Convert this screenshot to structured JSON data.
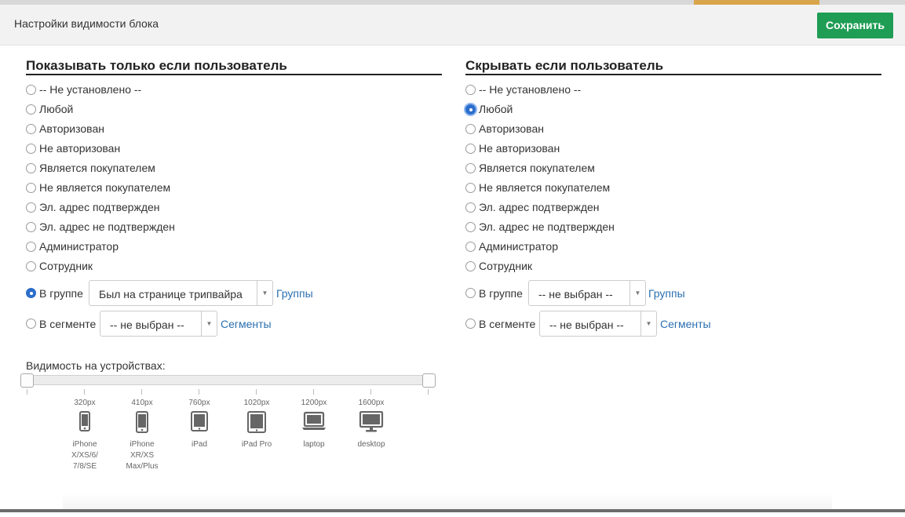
{
  "modal": {
    "title": "Настройки видимости блока",
    "save_label": "Сохранить"
  },
  "show_section": {
    "title": "Показывать только если пользователь",
    "options": [
      "-- Не установлено --",
      "Любой",
      "Авторизован",
      "Не авторизован",
      "Является покупателем",
      "Не является покупателем",
      "Эл. адрес подтвержден",
      "Эл. адрес не подтвержден",
      "Администратор",
      "Сотрудник"
    ],
    "selected": "В группе",
    "group": {
      "label": "В группе",
      "select_value": "Был на странице трипвайра",
      "link": "Группы"
    },
    "segment": {
      "label": "В сегменте",
      "select_value": "-- не выбран --",
      "link": "Сегменты"
    }
  },
  "hide_section": {
    "title": "Скрывать если пользователь",
    "options": [
      "-- Не установлено --",
      "Любой",
      "Авторизован",
      "Не авторизован",
      "Является покупателем",
      "Не является покупателем",
      "Эл. адрес подтвержден",
      "Эл. адрес не подтвержден",
      "Администратор",
      "Сотрудник"
    ],
    "selected": "Любой",
    "group": {
      "label": "В группе",
      "select_value": "-- не выбран --",
      "link": "Группы"
    },
    "segment": {
      "label": "В сегменте",
      "select_value": "-- не выбран --",
      "link": "Сегменты"
    }
  },
  "devices": {
    "label": "Видимость на устройствах:",
    "range_selected": [
      "320px",
      "1600px"
    ],
    "items": [
      {
        "px": "320px",
        "name_lines": [
          "iPhone",
          "X/XS/6/",
          "7/8/SE"
        ],
        "icon": "phone-icon"
      },
      {
        "px": "410px",
        "name_lines": [
          "iPhone",
          "XR/XS",
          "Max/Plus"
        ],
        "icon": "phone-large-icon"
      },
      {
        "px": "760px",
        "name_lines": [
          "iPad"
        ],
        "icon": "tablet-icon"
      },
      {
        "px": "1020px",
        "name_lines": [
          "iPad Pro"
        ],
        "icon": "tablet-large-icon"
      },
      {
        "px": "1200px",
        "name_lines": [
          "laptop"
        ],
        "icon": "laptop-icon"
      },
      {
        "px": "1600px",
        "name_lines": [
          "desktop"
        ],
        "icon": "desktop-icon"
      }
    ]
  },
  "colors": {
    "save_button": "#1f9d55",
    "link": "#2a6fb0",
    "radio_checked": "#2c6ecb"
  }
}
